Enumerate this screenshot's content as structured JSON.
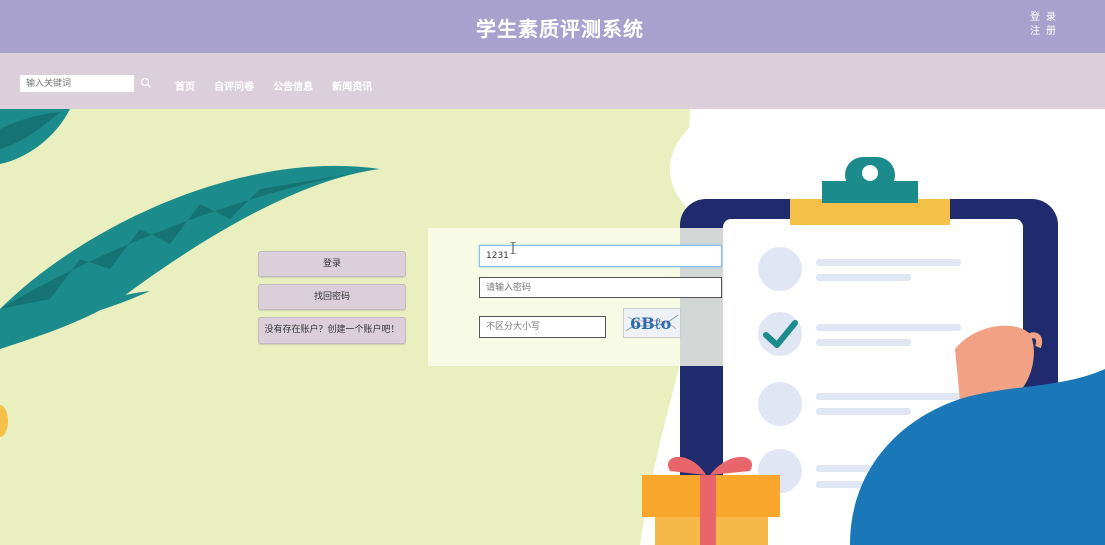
{
  "header": {
    "title": "学生素质评测系统",
    "login_label": "登录",
    "register_label": "注册"
  },
  "nav": {
    "search": {
      "placeholder": "输入关键词"
    },
    "links": [
      {
        "label": "首页"
      },
      {
        "label": "自评问卷"
      },
      {
        "label": "公告信息"
      },
      {
        "label": "新闻资讯"
      }
    ]
  },
  "login_form": {
    "buttons": {
      "login": "登录",
      "forgot_password": "找回密码",
      "register": "没有存在账户？创建一个账户吧！"
    },
    "username": {
      "value": "1231"
    },
    "password": {
      "placeholder": "请输入密码"
    },
    "captcha": {
      "placeholder": "不区分大小写",
      "image_text": "6Bℓo"
    }
  },
  "colors": {
    "header_bg": "#a9a1cd",
    "nav_bg": "#dbd0da",
    "hero_bg": "#e9efbf",
    "leaf": "#1c8b8b",
    "clipboard_frame": "#1f2b6c",
    "clip_yellow": "#f5c048",
    "sleeve_blue": "#1b78b8",
    "gift_orange": "#f8a72c",
    "ribbon_red": "#e8656b"
  }
}
